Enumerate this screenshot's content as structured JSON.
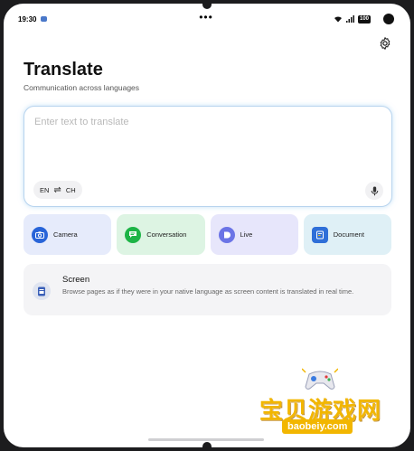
{
  "status_bar": {
    "time": "19:30",
    "dots": "•••",
    "battery": "100"
  },
  "header": {
    "title": "Translate",
    "subtitle": "Communication across languages"
  },
  "input": {
    "placeholder": "Enter text to translate",
    "value": "",
    "source_lang": "EN",
    "swap_symbol": "⇌",
    "target_lang": "CH"
  },
  "features": [
    {
      "label": "Camera",
      "bg": "#e6ebfb",
      "icon_color": "#2864d8"
    },
    {
      "label": "Conversation",
      "bg": "#ddf4e3",
      "icon_color": "#1db446"
    },
    {
      "label": "Live",
      "bg": "#e7e6fb",
      "icon_color": "#6b74e6"
    },
    {
      "label": "Document",
      "bg": "#dff0f6",
      "icon_color": "#2f6fd8"
    }
  ],
  "screen": {
    "title": "Screen",
    "description": "Browse pages as if they were in your native language as screen content is translated in real time."
  },
  "watermark": {
    "cn": "宝贝游戏网",
    "url": "baobeiy.com"
  }
}
